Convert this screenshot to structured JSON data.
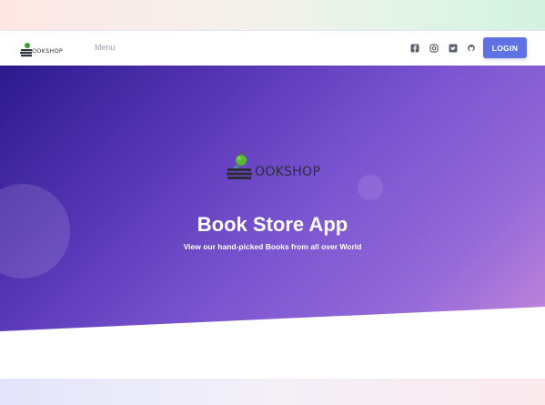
{
  "navbar": {
    "brand_text": "OOKSHOP",
    "menu_label": "Menu",
    "social_icons": [
      "facebook-icon",
      "instagram-icon",
      "twitter-icon",
      "github-icon"
    ],
    "login_label": "LOGIN"
  },
  "hero": {
    "brand_text": "OOKSHOP",
    "title": "Book Store App",
    "subtitle": "View our hand-picked Books from all over World"
  },
  "colors": {
    "accent": "#5e72e4",
    "hero_start": "#2b1a8c",
    "hero_end": "#c385dc"
  }
}
